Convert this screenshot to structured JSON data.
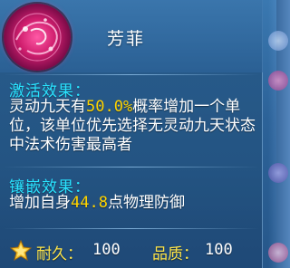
{
  "item": {
    "name": "芳菲",
    "icon": "red-spirit-orb-icon"
  },
  "activation": {
    "title": "激活效果：",
    "text_before": "灵动九天有",
    "chance": "50.0%",
    "text_after": "概率增加一个单位，该单位优先选择无灵动九天状态中法术伤害最高者"
  },
  "inlay": {
    "title": "镶嵌效果：",
    "text_before": "增加自身",
    "value": "44.8",
    "text_after": "点物理防御"
  },
  "stats": {
    "durability_label": "耐久：",
    "durability_value": "100",
    "quality_label": "品质：",
    "quality_value": "100"
  },
  "colors": {
    "section_title": "#29e3ff",
    "highlight": "#ffd400",
    "stat_label": "#ffe64a"
  }
}
